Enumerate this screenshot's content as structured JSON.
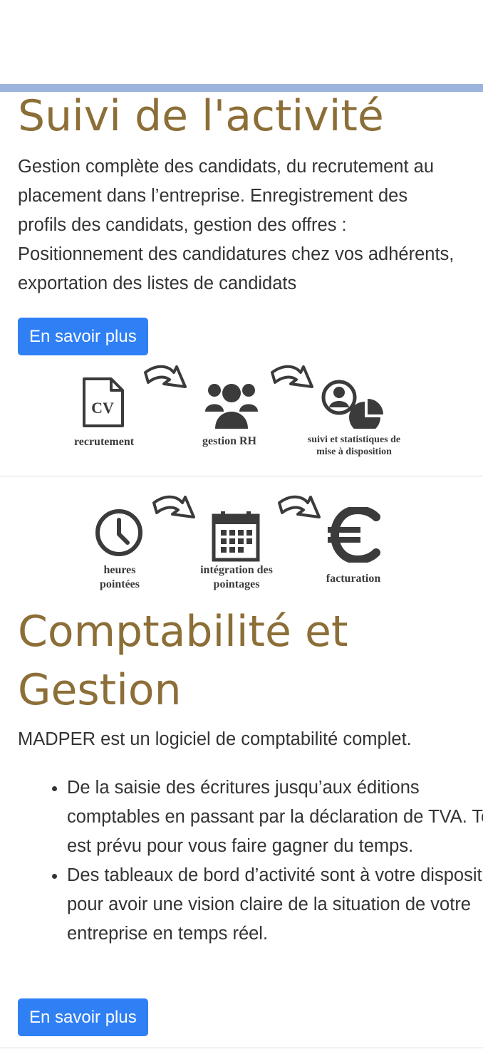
{
  "section1": {
    "title": "Suivi de l'activité",
    "description": "Gestion complète des candidats, du recrutement au placement dans l’entreprise. Enregistrement des profils des candidats, gestion des offres : Positionnement des candidatures chez vos adhérents, exportation des listes de candidats",
    "button": "En savoir plus",
    "steps": [
      {
        "icon": "cv-document-icon",
        "icon_text": "CV",
        "label": "recrutement"
      },
      {
        "icon": "people-group-icon",
        "label": "gestion RH"
      },
      {
        "icon": "user-stats-icon",
        "label_line1": "suivi et statistiques de",
        "label_line2": "mise à disposition"
      }
    ]
  },
  "section2": {
    "steps": [
      {
        "icon": "clock-icon",
        "label_line1": "heures",
        "label_line2": "pointées"
      },
      {
        "icon": "calendar-icon",
        "label_line1": "intégration des",
        "label_line2": "pointages"
      },
      {
        "icon": "euro-icon",
        "label": "facturation"
      }
    ],
    "title_line1": "Comptabilité et",
    "title_line2": "Gestion",
    "intro": "MADPER est un logiciel de comptabilité complet.",
    "bullets": [
      "De la saisie des écritures jusqu’aux éditions comptables en passant par la déclaration de TVA. Tout est prévu pour vous faire gagner du temps.",
      "Des tableaux de bord d’activité sont à votre disposition pour avoir une vision claire de la situation de votre entreprise en temps réel."
    ],
    "button": "En savoir plus"
  },
  "colors": {
    "title": "#8c6e37",
    "button": "#2f7ff5",
    "top_bar": "#9db5dc",
    "icon": "#3b3b3b"
  }
}
